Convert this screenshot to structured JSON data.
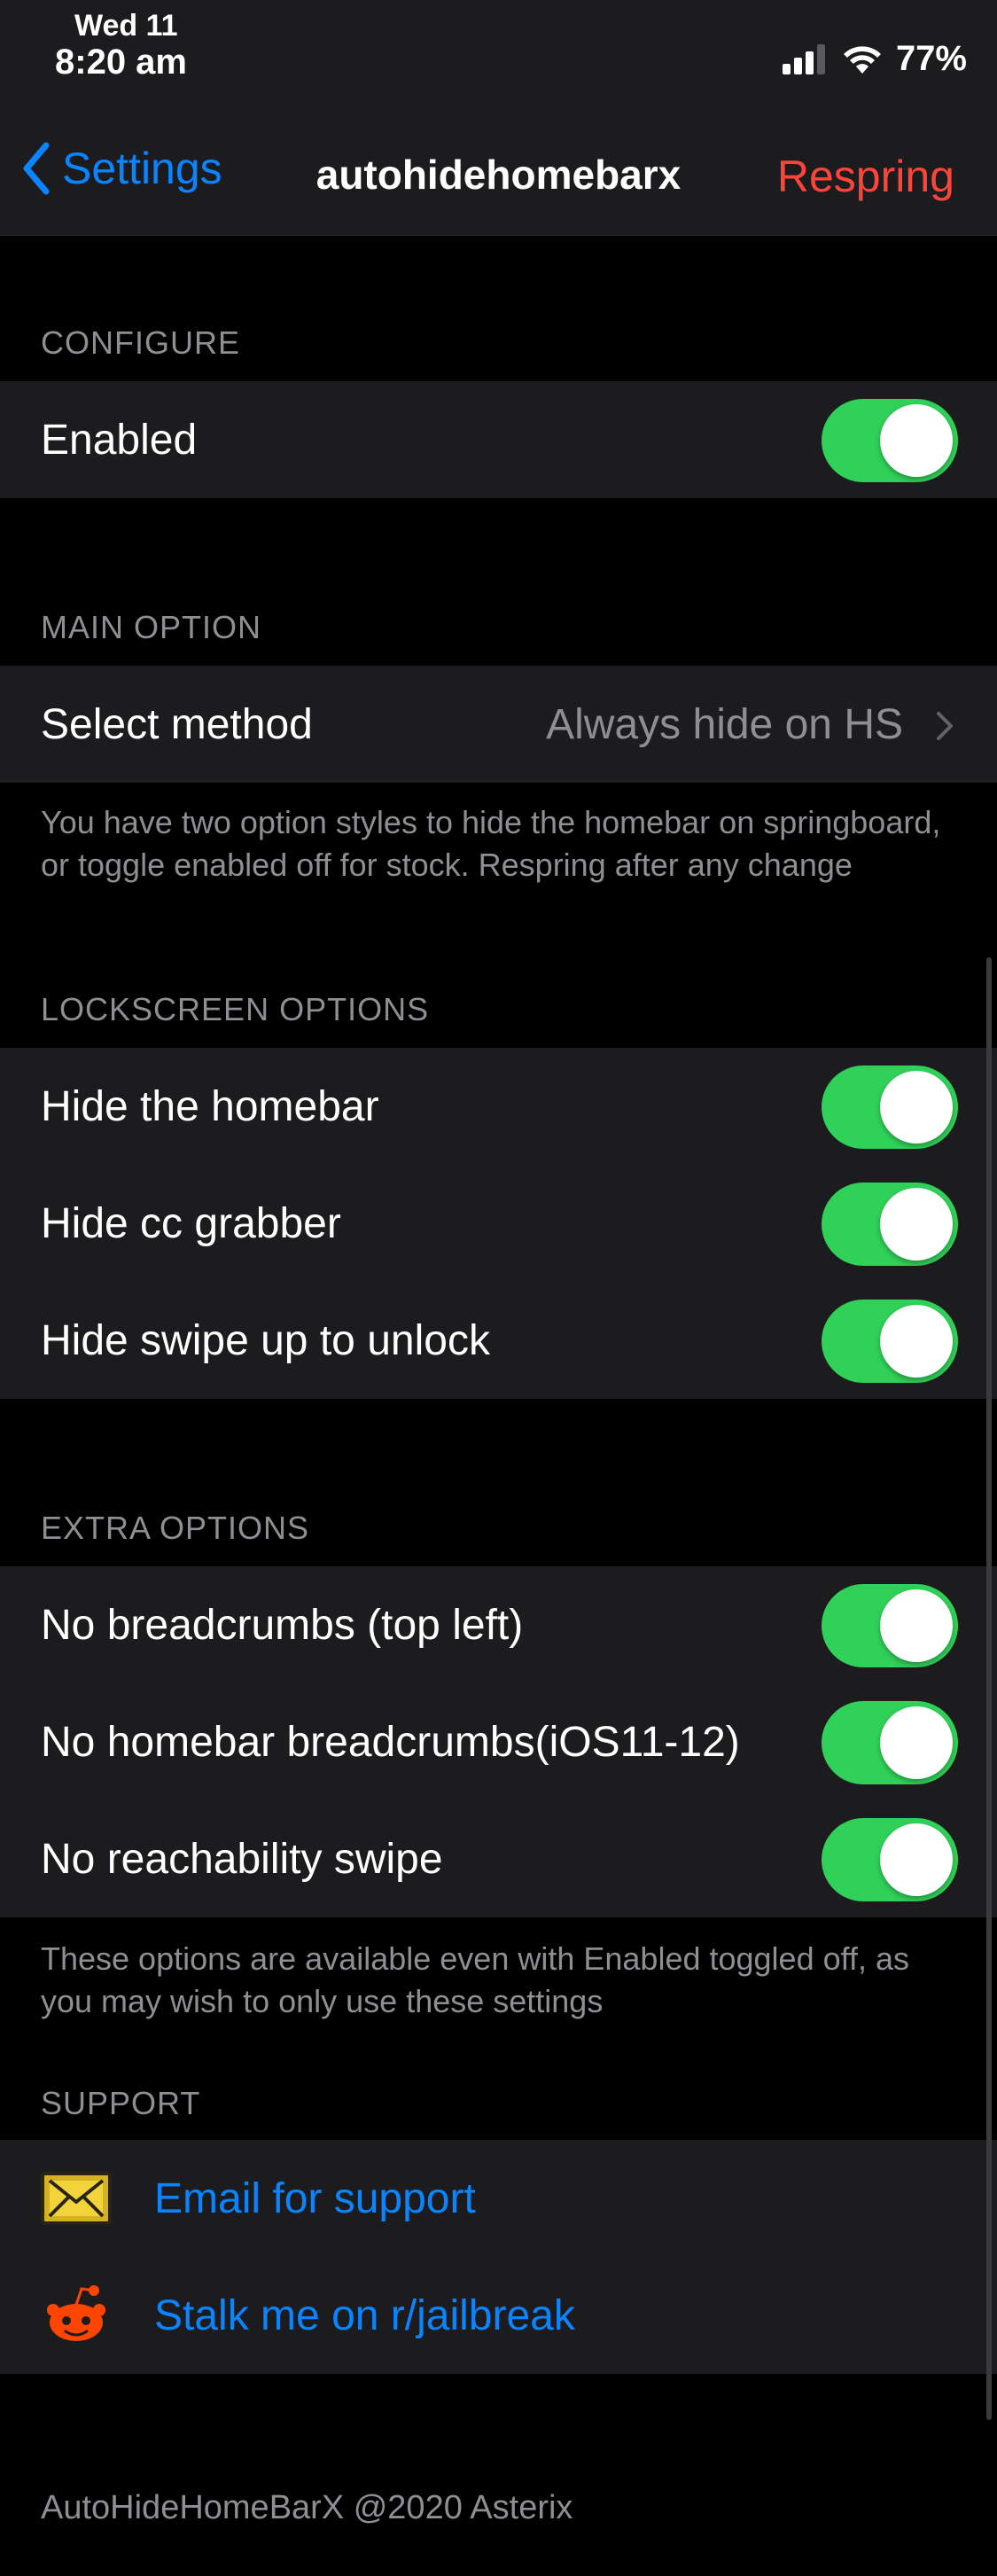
{
  "status_bar": {
    "day": "Wed 11",
    "time": "8:20 am",
    "battery": "77%"
  },
  "nav": {
    "back_label": "Settings",
    "title": "autohidehomebarx",
    "action_label": "Respring"
  },
  "configure": {
    "header": "CONFIGURE",
    "items": [
      {
        "label": "Enabled",
        "on": true
      }
    ]
  },
  "main_option": {
    "header": "MAIN OPTION",
    "select_label": "Select method",
    "select_value": "Always hide on HS",
    "footer": "You have two option styles to hide the homebar on springboard, or toggle enabled off for stock. Respring after any change"
  },
  "lockscreen": {
    "header": "LOCKSCREEN OPTIONS",
    "items": [
      {
        "label": "Hide the homebar",
        "on": true
      },
      {
        "label": "Hide cc grabber",
        "on": true
      },
      {
        "label": "Hide swipe up to unlock",
        "on": true
      }
    ]
  },
  "extra": {
    "header": "EXTRA OPTIONS",
    "items": [
      {
        "label": "No breadcrumbs (top left)",
        "on": true
      },
      {
        "label": "No homebar breadcrumbs(iOS11-12)",
        "on": true
      },
      {
        "label": "No reachability swipe",
        "on": true
      }
    ],
    "footer": "These options are available even with Enabled toggled off, as you may wish to only use these settings"
  },
  "support": {
    "header": "SUPPORT",
    "items": [
      {
        "label": "Email for support",
        "icon": "envelope-icon"
      },
      {
        "label": "Stalk me on r/jailbreak",
        "icon": "reddit-icon"
      }
    ]
  },
  "copyright": "AutoHideHomeBarX @2020 Asterix",
  "colors": {
    "accent": "#0a84ff",
    "destructive": "#ff453a",
    "toggle_on": "#30d158",
    "cell_bg": "#1c1c1e",
    "secondary_text": "#8e8e93"
  }
}
